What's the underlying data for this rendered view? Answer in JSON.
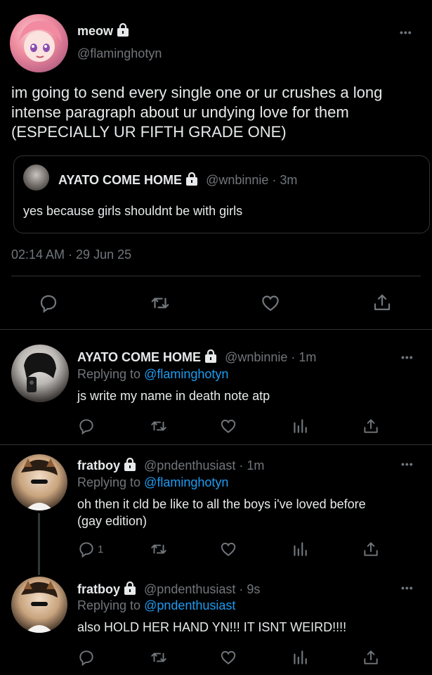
{
  "main_tweet": {
    "display_name": "meow",
    "handle": "@flaminghotyn",
    "text": "im going to send every single one or ur crushes a long intense paragraph about ur undying love for them (ESPECIALLY UR FIFTH GRADE ONE)",
    "timestamp": "02:14 AM · 29 Jun 25",
    "more": "•••"
  },
  "quote": {
    "display_name": "AYATO COME HOME",
    "handle": "@wnbinnie",
    "time": "· 3m",
    "text": "yes because girls shouldnt be with girls"
  },
  "replies": [
    {
      "display_name": "AYATO COME HOME",
      "handle": "@wnbinnie",
      "time": "· 1m",
      "replying_prefix": "Replying to",
      "replying_to": "@flaminghotyn",
      "text_lines": [
        "js write my name in death note atp"
      ],
      "reply_count": ""
    },
    {
      "display_name": "fratboy",
      "handle": "@pndenthusiast",
      "time": "· 1m",
      "replying_prefix": "Replying to",
      "replying_to": "@flaminghotyn",
      "text_lines": [
        "oh then it cld be like to all the boys i've loved before",
        "(gay edition)"
      ],
      "reply_count": "1"
    },
    {
      "display_name": "fratboy",
      "handle": "@pndenthusiast",
      "time": "· 9s",
      "replying_prefix": "Replying to",
      "replying_to": "@pndenthusiast",
      "text_lines": [
        "also HOLD HER HAND YN!!! IT ISNT WEIRD!!!!"
      ],
      "reply_count": ""
    }
  ],
  "colors": {
    "background": "#000000",
    "text": "#e7e9ea",
    "muted": "#71767b",
    "link": "#1d9bf0",
    "divider": "#2f3336"
  },
  "icons": [
    "lock-icon",
    "more-icon",
    "reply-icon",
    "retweet-icon",
    "like-icon",
    "views-icon",
    "share-icon"
  ]
}
